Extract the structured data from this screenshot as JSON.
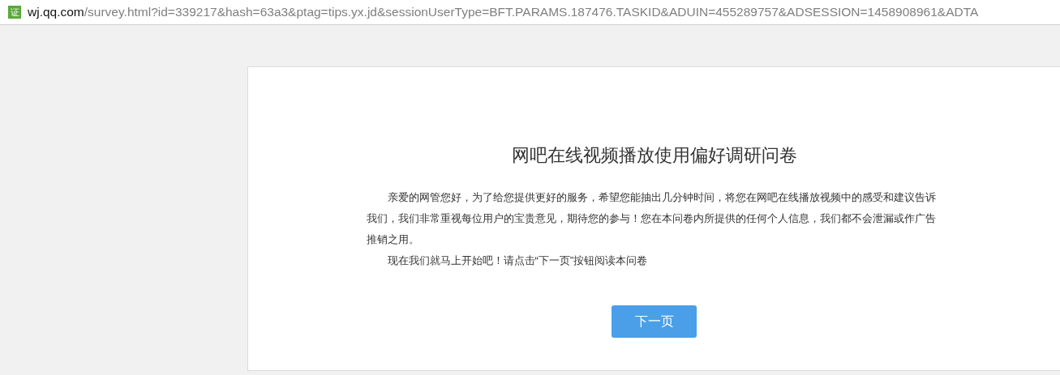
{
  "address_bar": {
    "badge": "证",
    "host": "wj.qq.com",
    "path": "/survey.html?id=339217&hash=63a3&ptag=tips.yx.jd&sessionUserType=BFT.PARAMS.187476.TASKID&ADUIN=455289757&ADSESSION=1458908961&ADTA"
  },
  "survey": {
    "title": "网吧在线视频播放使用偏好调研问卷",
    "paragraphs": [
      "亲爱的网管您好，为了给您提供更好的服务，希望您能抽出几分钟时间，将您在网吧在线播放视频中的感受和建议告诉我们，我们非常重视每位用户的宝贵意见，期待您的参与！您在本问卷内所提供的任何个人信息，我们都不会泄漏或作广告推销之用。",
      "现在我们就马上开始吧！请点击“下一页”按钮阅读本问卷"
    ],
    "next_button": "下一页"
  }
}
